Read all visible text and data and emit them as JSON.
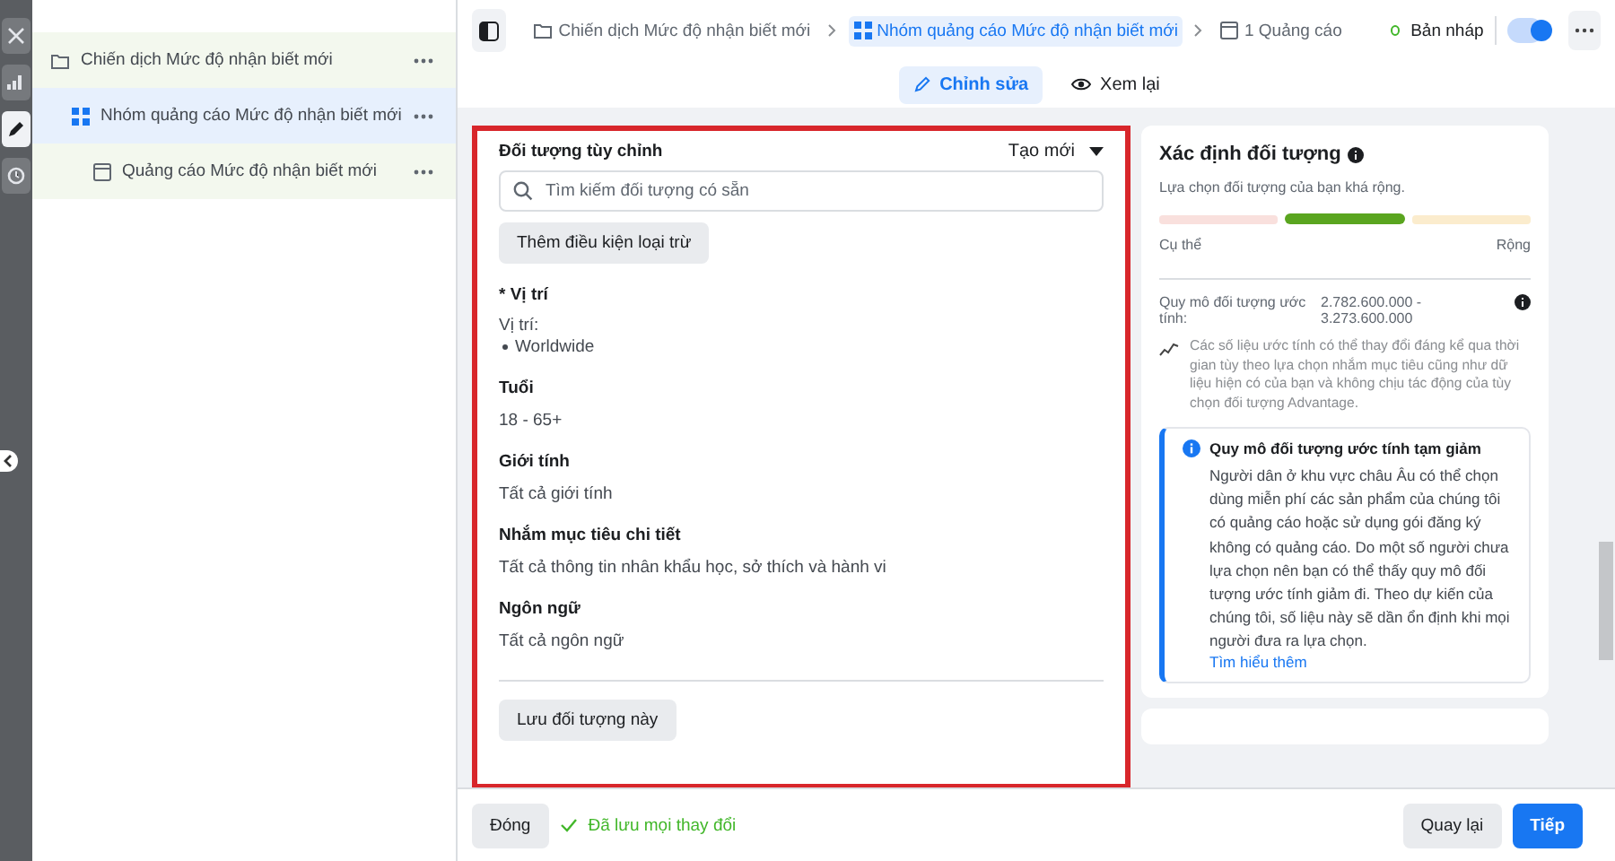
{
  "rail": {
    "items": [
      {
        "kind": "close",
        "selected": false
      },
      {
        "kind": "chart",
        "selected": false
      },
      {
        "kind": "edit",
        "selected": true
      },
      {
        "kind": "clock",
        "selected": false
      }
    ]
  },
  "tree": [
    {
      "kind": "campaign",
      "label": "Chiến dịch Mức độ nhận biết mới",
      "selected": false,
      "children": [
        {
          "kind": "adset",
          "label": "Nhóm quảng cáo Mức độ nhận biết mới",
          "selected": true,
          "children": [
            {
              "kind": "ad",
              "label": "Quảng cáo Mức độ nhận biết mới",
              "selected": false
            }
          ]
        }
      ]
    }
  ],
  "breadcrumbs": [
    {
      "kind": "campaign",
      "label": "Chiến dịch Mức độ nhận biết mới",
      "selected": false
    },
    {
      "kind": "adset",
      "label": "Nhóm quảng cáo Mức độ nhận biết mới",
      "selected": true
    },
    {
      "kind": "ad",
      "label": "1 Quảng cáo",
      "selected": false
    }
  ],
  "status": {
    "label": "Bản nháp",
    "color": "#42b72a",
    "on": true
  },
  "mode_tabs": [
    {
      "kind": "edit",
      "label": "Chỉnh sửa",
      "selected": true
    },
    {
      "kind": "view",
      "label": "Xem lại",
      "selected": false
    }
  ],
  "form": {
    "title": "Đối tượng tùy chỉnh",
    "create_menu": "Tạo mới",
    "search": {
      "placeholder": "Tìm kiếm đối tượng có sẵn"
    },
    "exclude_button": "Thêm điều kiện loại trừ",
    "location": {
      "title": "* Vị trí",
      "label": "Vị trí:",
      "items": [
        "Worldwide"
      ]
    },
    "sections": [
      {
        "title": "Tuổi",
        "value": "18 - 65+"
      },
      {
        "title": "Giới tính",
        "value": "Tất cả giới tính"
      },
      {
        "title": "Nhắm mục tiêu chi tiết",
        "value": "Tất cả thông tin nhân khẩu học, sở thích và hành vi"
      },
      {
        "title": "Ngôn ngữ",
        "value": "Tất cả ngôn ngữ"
      }
    ],
    "save_button": "Lưu đối tượng này"
  },
  "audience": {
    "title": "Xác định đối tượng",
    "subtitle": "Lựa chọn đối tượng của bạn khá rộng.",
    "segments": [
      {
        "color": "#f9e0dd",
        "selected": false
      },
      {
        "color": "#5aa51f",
        "selected": true
      },
      {
        "color": "#fbeccd",
        "selected": false
      }
    ],
    "left_label": "Cụ thể",
    "right_label": "Rộng",
    "size_label": "Quy mô đối tượng ước tính:",
    "size_value": "2.782.600.000 - 3.273.600.000",
    "note": "Các số liệu ước tính có thể thay đổi đáng kể qua thời gian tùy theo lựa chọn nhắm mục tiêu cũng như dữ liệu hiện có của bạn và không chịu tác động của tùy chọn đối tượng Advantage.",
    "notice": {
      "title": "Quy mô đối tượng ước tính tạm giảm",
      "body": "Người dân ở khu vực châu Âu có thể chọn dùng miễn phí các sản phẩm của chúng tôi có quảng cáo hoặc sử dụng gói đăng ký không có quảng cáo. Do một số người chưa lựa chọn nên bạn có thể thấy quy mô đối tượng ước tính giảm đi. Theo dự kiến của chúng tôi, số liệu này sẽ dần ổn định khi mọi người đưa ra lựa chọn.",
      "link": "Tìm hiểu thêm"
    }
  },
  "footer": {
    "close_button": "Đóng",
    "saved": "Đã lưu mọi thay đổi",
    "back_button": "Quay lại",
    "next_button": "Tiếp"
  }
}
